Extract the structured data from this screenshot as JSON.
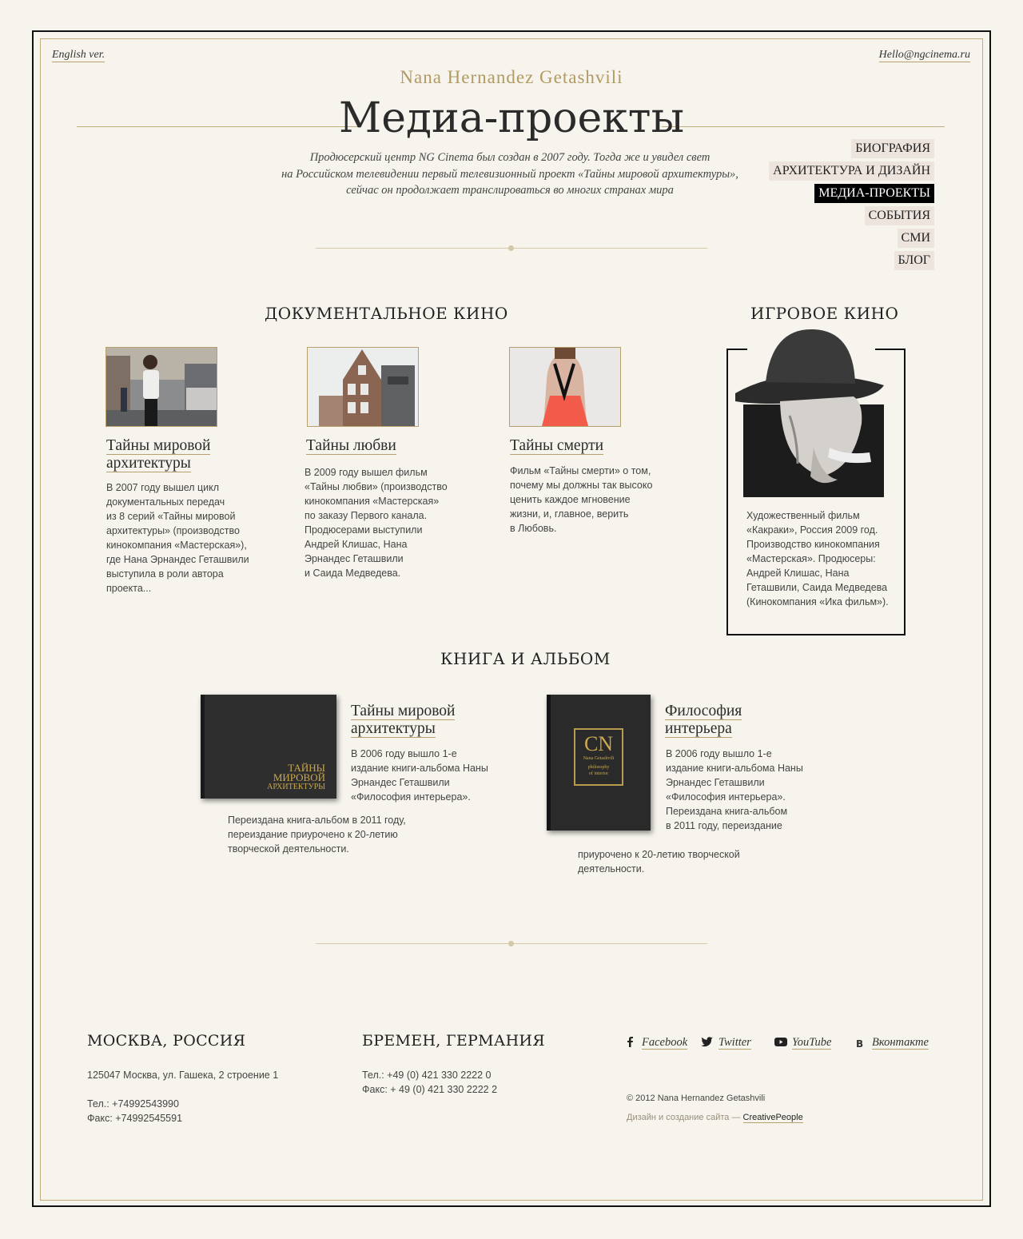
{
  "header": {
    "lang_link": "English ver.",
    "email_link": "Hello@ngcinema.ru",
    "brand": "Nana Hernandez Getashvili",
    "page_title": "Медиа-проекты",
    "intro": [
      "Продюсерский центр NG Cinema был создан в 2007 году. Тогда же и увидел свет",
      "на Российском телевидении первый телевизионный проект «Тайны мировой архитектуры»,",
      "сейчас он продолжает транслироваться во многих странах мира"
    ]
  },
  "nav": {
    "items": [
      {
        "label": "БИОГРАФИЯ",
        "active": false
      },
      {
        "label": "АРХИТЕКТУРА И ДИЗАЙН",
        "active": false
      },
      {
        "label": "МЕДИА-ПРОЕКТЫ",
        "active": true
      },
      {
        "label": "СОБЫТИЯ",
        "active": false
      },
      {
        "label": "СМИ",
        "active": false
      },
      {
        "label": "БЛОГ",
        "active": false
      }
    ]
  },
  "documentary": {
    "title": "ДОКУМЕНТАЛЬНОЕ КИНО",
    "cards": [
      {
        "title": [
          "Тайны мировой",
          "архитектуры"
        ],
        "desc": [
          "В 2007 году вышел цикл",
          "документальных передач",
          "из 8 серий «Тайны мировой",
          "архитектуры» (производство",
          "кинокомпания «Мастерская»),",
          "где Нана Эрнандес Геташвили",
          "выступила в роли автора",
          "проекта..."
        ]
      },
      {
        "title": [
          "Тайны любви"
        ],
        "desc": [
          "В 2009 году вышел фильм",
          "«Тайны любви» (производство",
          "кинокомпания «Мастерская»",
          "по заказу Первого канала.",
          "Продюсерами выступили",
          "Андрей Клишас, Нана",
          "Эрнандес Геташвили",
          "и Саида Медведева."
        ]
      },
      {
        "title": [
          "Тайны смерти"
        ],
        "desc": [
          "Фильм «Тайны смерти» о том,",
          "почему мы должны так высоко",
          "ценить каждое мгновение",
          "жизни, и, главное, верить",
          "в Любовь."
        ]
      }
    ]
  },
  "feature": {
    "title": "ИГРОВОЕ КИНО",
    "desc": [
      "Художественный фильм",
      "«Какраки», Россия 2009 год.",
      "Производство кинокомпания",
      "«Мастерская». Продюсеры:",
      "Андрей Клишас, Нана",
      "Геташвили, Саида Медведева",
      "(Кинокомпания «Ика фильм»)."
    ]
  },
  "books": {
    "title": "КНИГА И АЛЬБОМ",
    "items": [
      {
        "title": [
          "Тайны мировой",
          "архитектуры"
        ],
        "cover_text": [
          "ТАЙНЫ",
          "МИРОВОЙ",
          "АРХИТЕКТУРЫ"
        ],
        "desc": [
          "В 2006 году вышло 1-е",
          "издание книги-альбома Наны",
          "Эрнандес Геташвили",
          "«Философия интерьера»."
        ],
        "desc2": [
          "Переиздана книга-альбом в 2011 году,",
          "переиздание приурочено к 20-летию",
          "творческой деятельности."
        ]
      },
      {
        "title": [
          "Философия",
          "интерьера"
        ],
        "cover_text": [
          "Nana Getashvili",
          "philosophy",
          "of interior"
        ],
        "desc": [
          "В 2006 году вышло 1-е",
          "издание книги-альбома Наны",
          "Эрнандес Геташвили",
          "«Философия интерьера».",
          "Переиздана книга-альбом",
          "в 2011 году, переиздание"
        ],
        "desc2": [
          "приурочено к 20-летию творческой",
          "деятельности."
        ]
      }
    ]
  },
  "footer": {
    "moscow": {
      "city": "МОСКВА, РОССИЯ",
      "address": "125047 Москва, ул. Гашека, 2 строение 1",
      "phone": "Тел.: +74992543990",
      "fax": "Факс: +74992545591"
    },
    "bremen": {
      "city": "БРЕМЕН, ГЕРМАНИЯ",
      "phone": "Тел.: +49 (0) 421 330 2222 0",
      "fax": "Факс: + 49 (0) 421 330 2222 2"
    },
    "social": [
      {
        "icon": "facebook-icon",
        "label": "Facebook"
      },
      {
        "icon": "twitter-icon",
        "label": "Twitter"
      },
      {
        "icon": "youtube-icon",
        "label": "YouTube"
      },
      {
        "icon": "vk-icon",
        "label": "Вконтакте"
      }
    ],
    "copyright": "© 2012 Nana Hernandez Getashvili",
    "credit_prefix": "Дизайн и создание сайта — ",
    "credit_link": "CreativePeople"
  },
  "colors": {
    "accent_gold": "#b19a63",
    "background": "#f6f4ec",
    "text": "#333333",
    "nav_bg": "#ede4dd",
    "nav_active_bg": "#000000"
  }
}
